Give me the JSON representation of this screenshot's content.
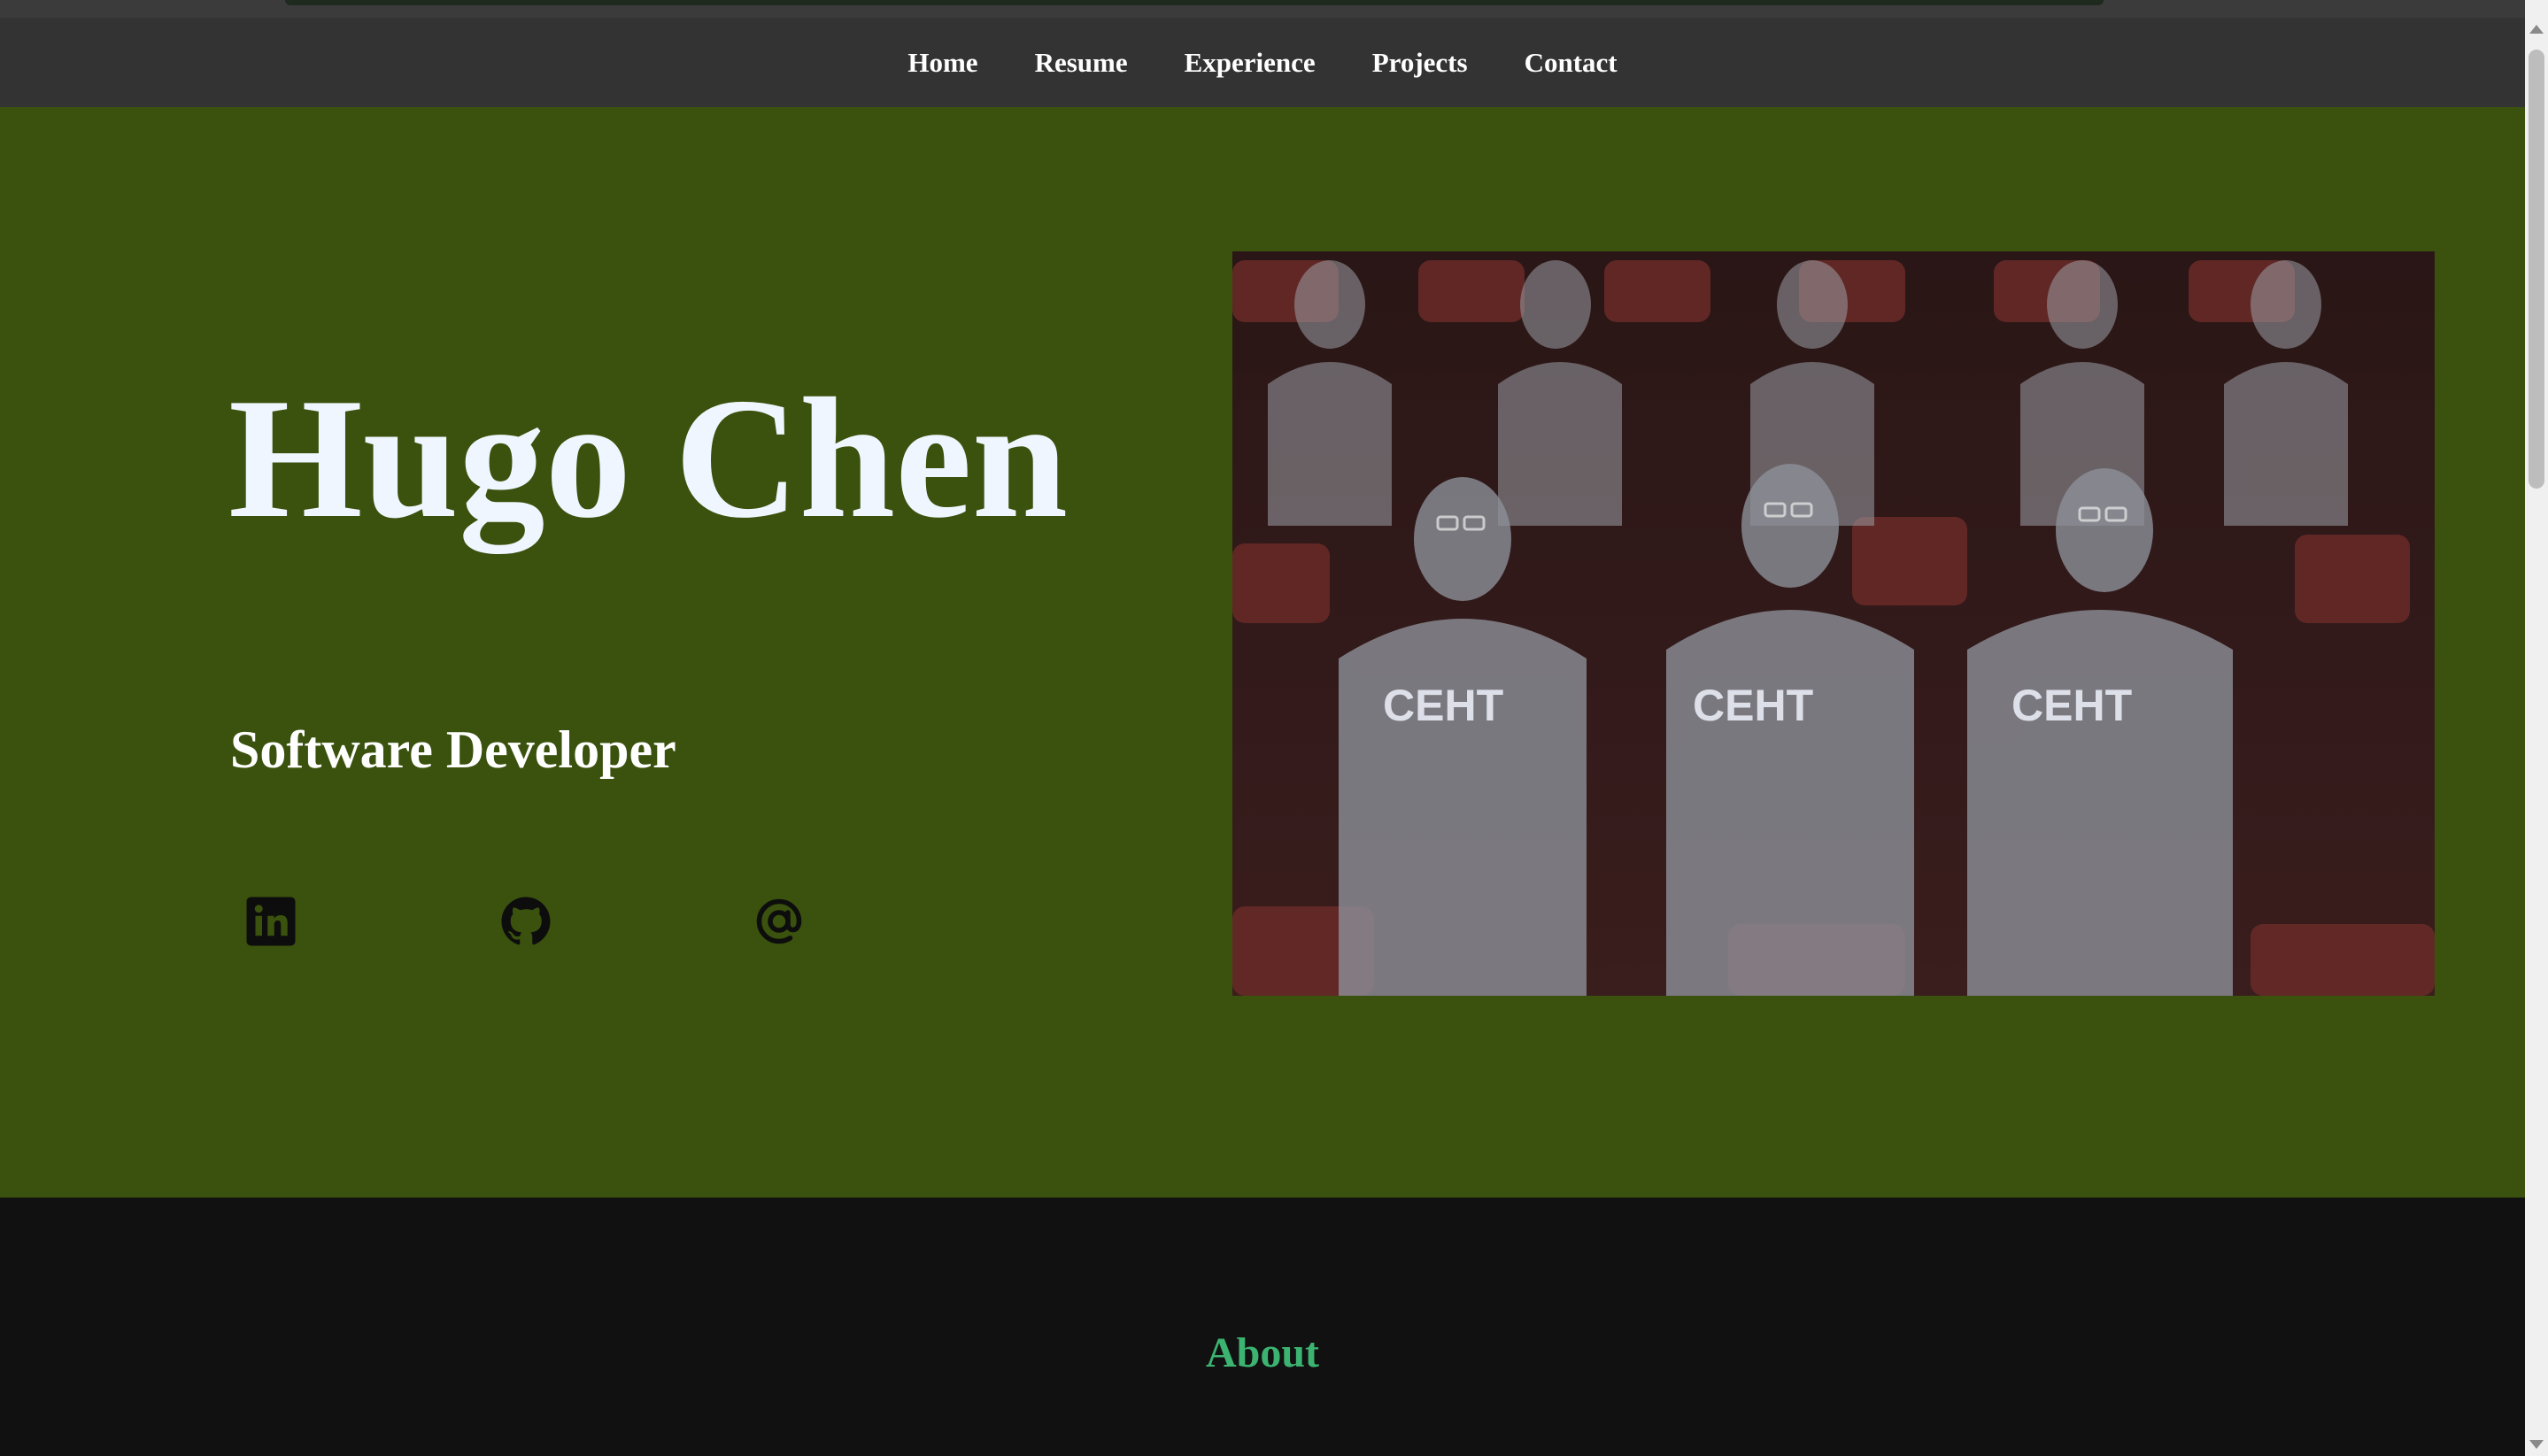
{
  "nav": {
    "items": [
      {
        "label": "Home"
      },
      {
        "label": "Resume"
      },
      {
        "label": "Experience"
      },
      {
        "label": "Projects"
      },
      {
        "label": "Contact"
      }
    ]
  },
  "hero": {
    "name": "Hugo Chen",
    "role": "Software Developer",
    "photo_alt": "Hugo Chen",
    "social": [
      {
        "icon": "linkedin-icon"
      },
      {
        "icon": "github-icon"
      },
      {
        "icon": "at-sign-icon"
      }
    ]
  },
  "about": {
    "title": "About"
  },
  "colors": {
    "nav_background": "#333333",
    "hero_background": "#3a520d",
    "section_background": "#111111",
    "accent": "#3cb371"
  }
}
